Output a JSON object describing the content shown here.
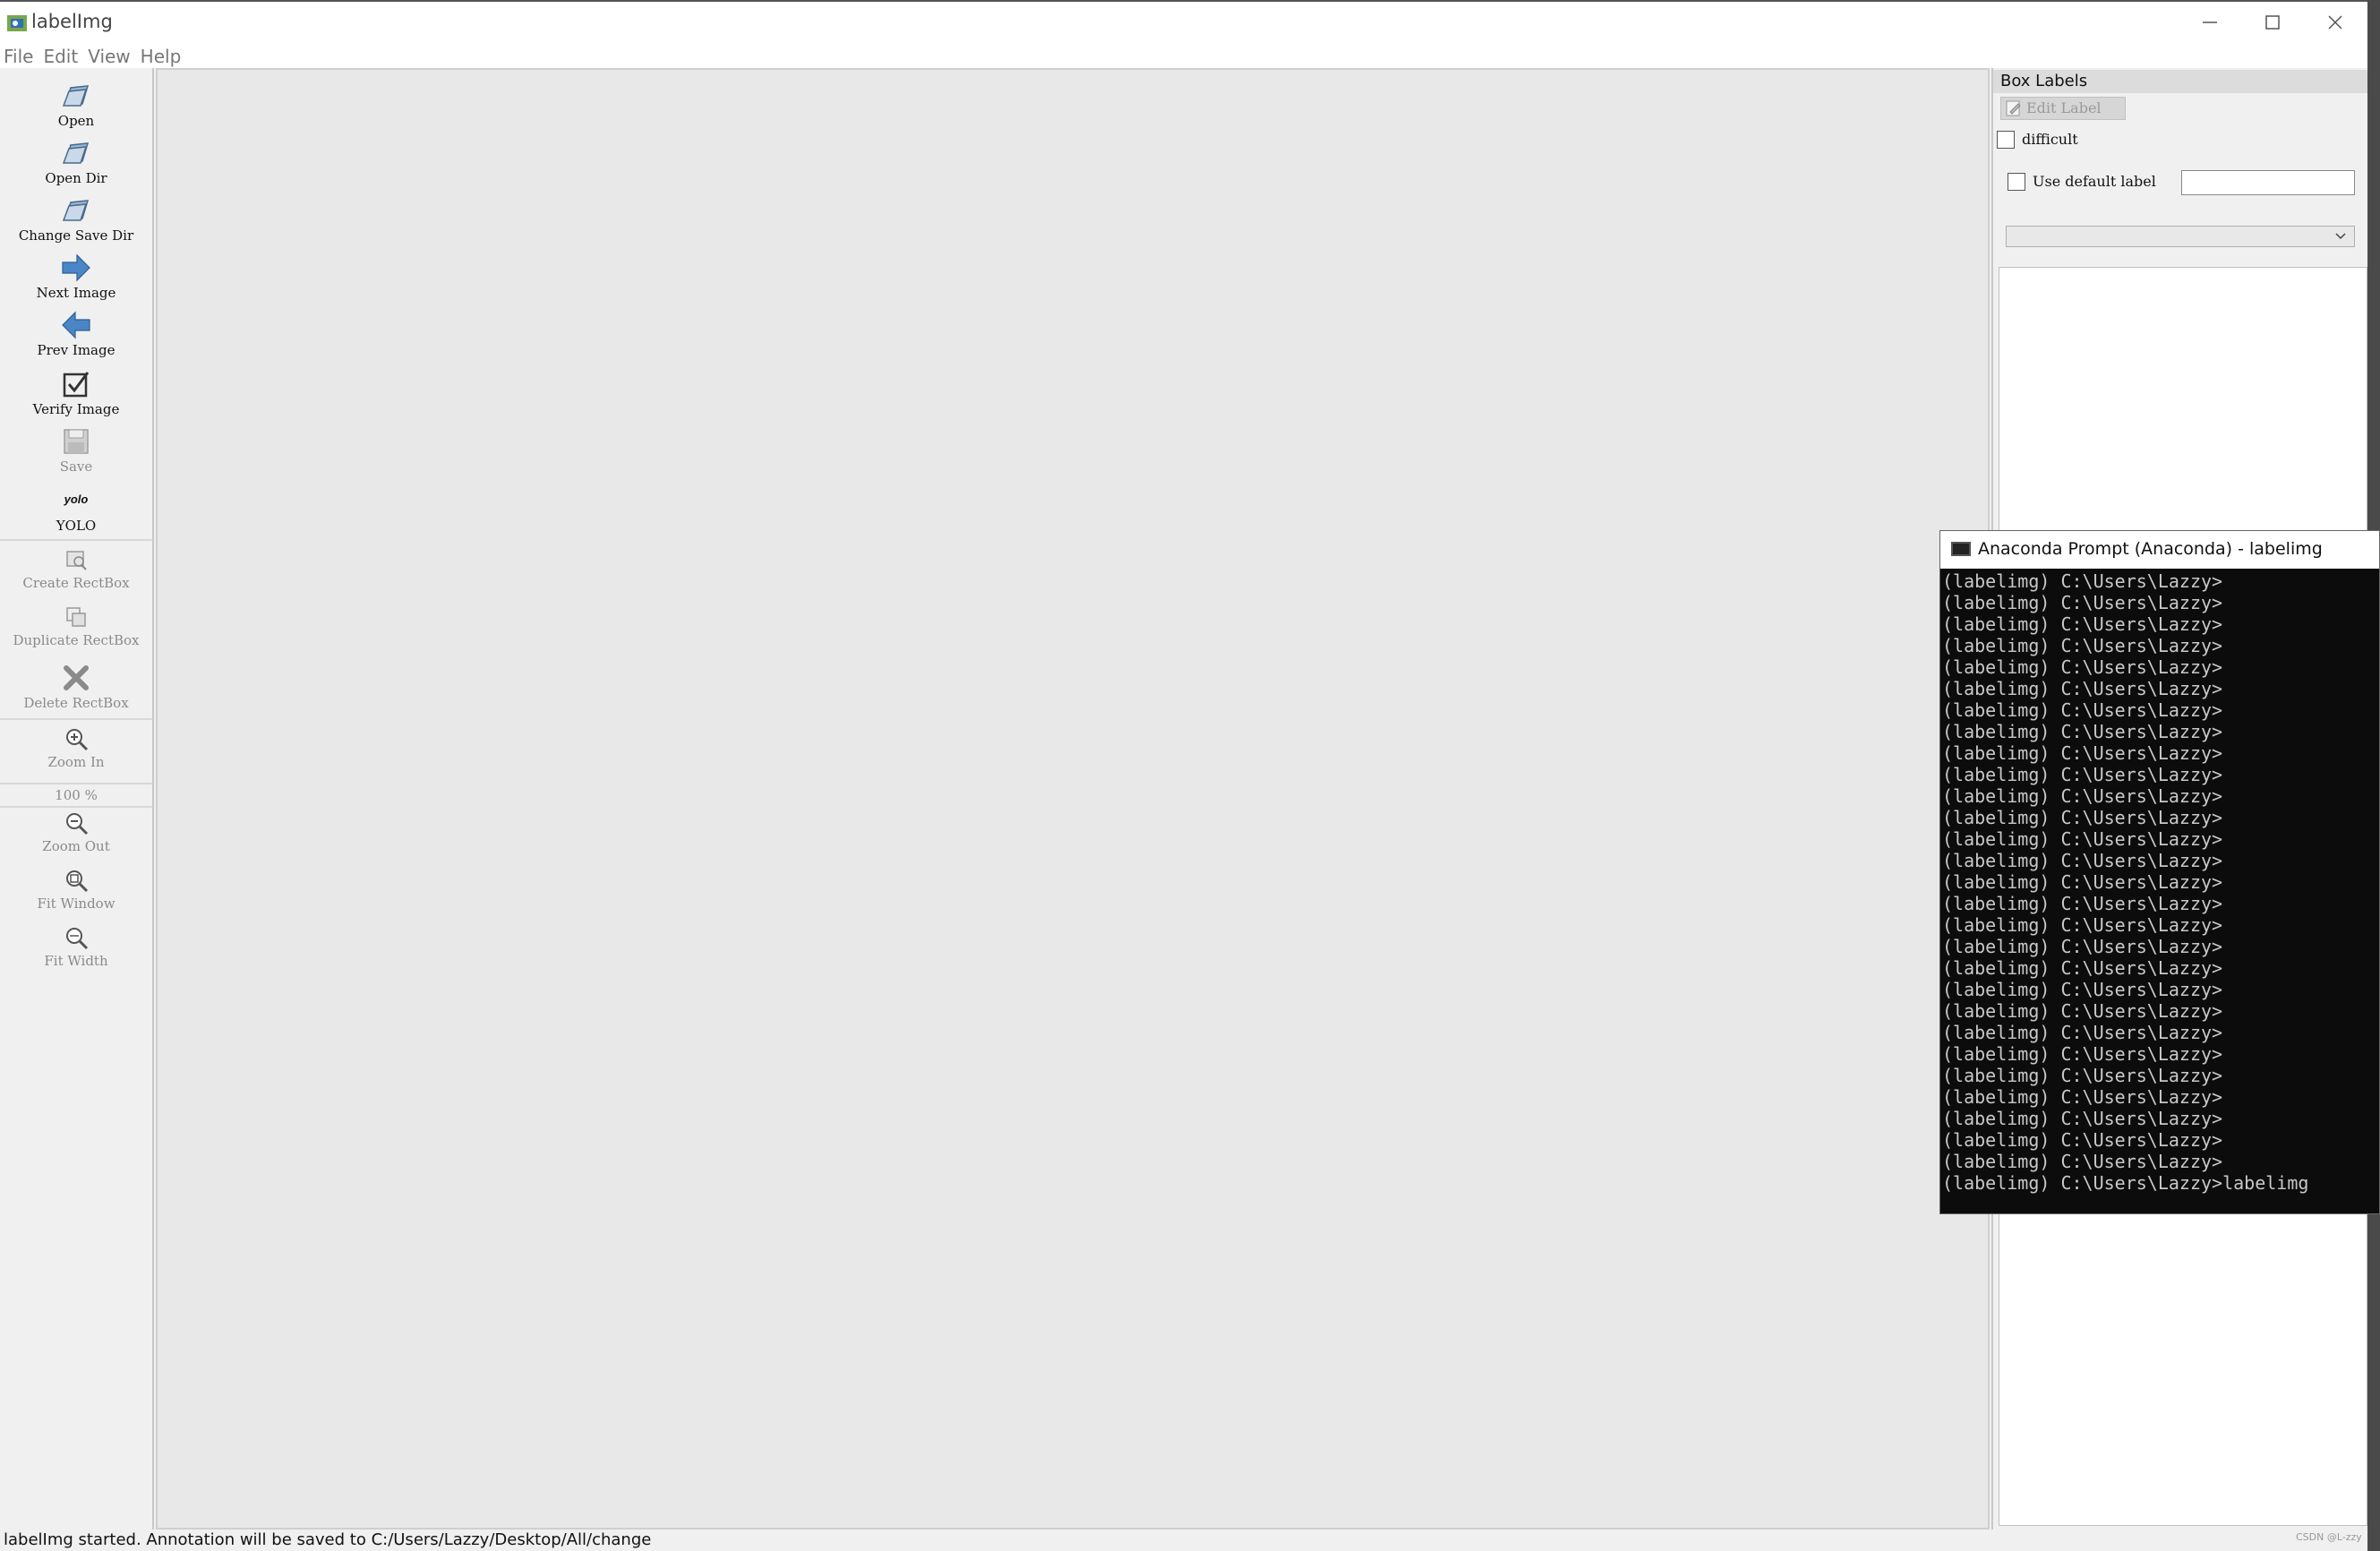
{
  "window": {
    "title": "labelImg",
    "controls": [
      "minimize",
      "maximize",
      "close"
    ]
  },
  "menu": [
    "File",
    "Edit",
    "View",
    "Help"
  ],
  "toolbar": {
    "open": "Open",
    "open_dir": "Open Dir",
    "change_save_dir": "Change Save Dir",
    "next_image": "Next Image",
    "prev_image": "Prev Image",
    "verify_image": "Verify Image",
    "save": "Save",
    "format_icon_text": "yolo",
    "format": "YOLO",
    "create_rectbox": "Create RectBox",
    "duplicate_rectbox": "Duplicate RectBox",
    "delete_rectbox": "Delete RectBox",
    "zoom_in": "Zoom In",
    "zoom_level": "100 %",
    "zoom_out": "Zoom Out",
    "fit_window": "Fit Window",
    "fit_width": "Fit Width"
  },
  "dock": {
    "title": "Box Labels",
    "edit_label": "Edit Label",
    "difficult": "difficult",
    "use_default_label": "Use default label",
    "default_label_value": "",
    "label_combo_value": ""
  },
  "status": "labelImg started. Annotation will be saved to C:/Users/Lazzy/Desktop/All/change",
  "terminal": {
    "title": "Anaconda Prompt (Anaconda) - labelimg",
    "lines": [
      "(labelimg) C:\\Users\\Lazzy>",
      "(labelimg) C:\\Users\\Lazzy>",
      "(labelimg) C:\\Users\\Lazzy>",
      "(labelimg) C:\\Users\\Lazzy>",
      "(labelimg) C:\\Users\\Lazzy>",
      "(labelimg) C:\\Users\\Lazzy>",
      "(labelimg) C:\\Users\\Lazzy>",
      "(labelimg) C:\\Users\\Lazzy>",
      "(labelimg) C:\\Users\\Lazzy>",
      "(labelimg) C:\\Users\\Lazzy>",
      "(labelimg) C:\\Users\\Lazzy>",
      "(labelimg) C:\\Users\\Lazzy>",
      "(labelimg) C:\\Users\\Lazzy>",
      "(labelimg) C:\\Users\\Lazzy>",
      "(labelimg) C:\\Users\\Lazzy>",
      "(labelimg) C:\\Users\\Lazzy>",
      "(labelimg) C:\\Users\\Lazzy>",
      "(labelimg) C:\\Users\\Lazzy>",
      "(labelimg) C:\\Users\\Lazzy>",
      "(labelimg) C:\\Users\\Lazzy>",
      "(labelimg) C:\\Users\\Lazzy>",
      "(labelimg) C:\\Users\\Lazzy>",
      "(labelimg) C:\\Users\\Lazzy>",
      "(labelimg) C:\\Users\\Lazzy>",
      "(labelimg) C:\\Users\\Lazzy>",
      "(labelimg) C:\\Users\\Lazzy>",
      "(labelimg) C:\\Users\\Lazzy>",
      "(labelimg) C:\\Users\\Lazzy>",
      "(labelimg) C:\\Users\\Lazzy>labelimg"
    ]
  },
  "watermark": "CSDN @L-zzy"
}
